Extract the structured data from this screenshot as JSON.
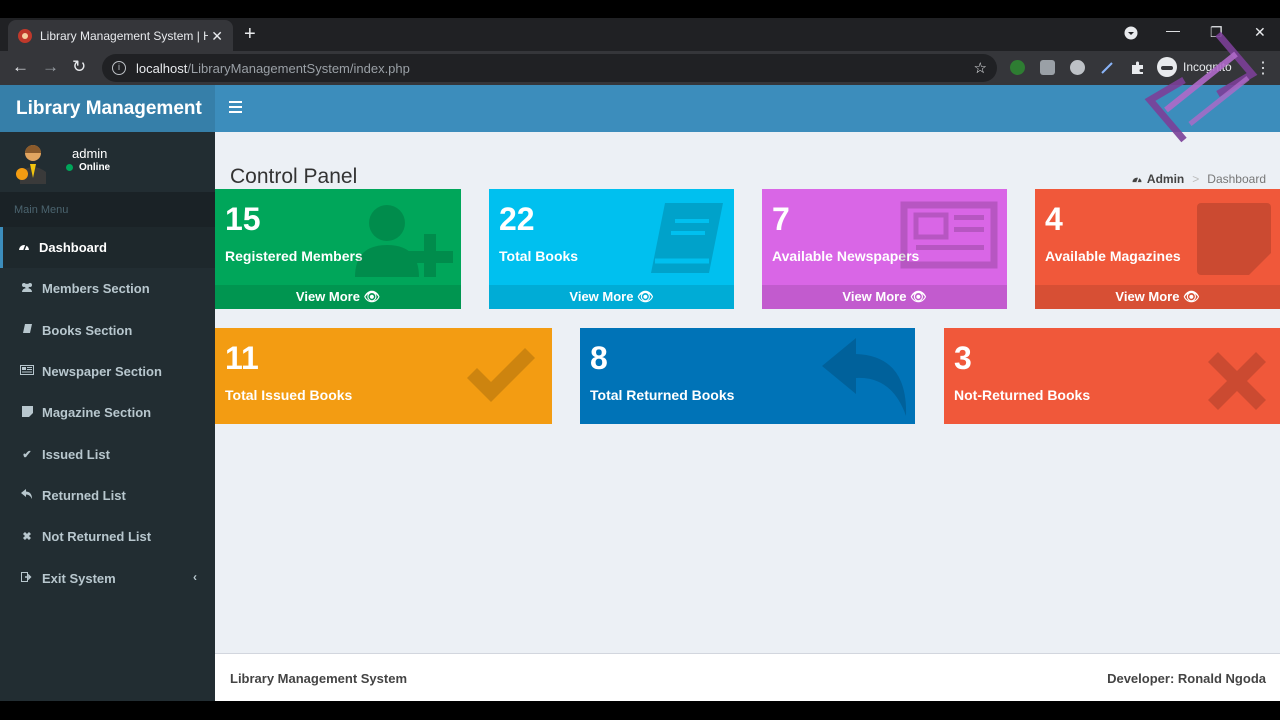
{
  "browser": {
    "tab_title": "Library Management System | Ho",
    "url_host": "localhost",
    "url_path": "/LibraryManagementSystem/index.php",
    "incognito_label": "Incognito"
  },
  "app": {
    "brand": "Library Management",
    "user": {
      "name": "admin",
      "status": "Online"
    },
    "menu_header": "Main Menu",
    "menu": [
      {
        "label": "Dashboard",
        "icon": "dashboard-icon",
        "active": true
      },
      {
        "label": "Members Section",
        "icon": "users-icon"
      },
      {
        "label": "Books Section",
        "icon": "book-icon"
      },
      {
        "label": "Newspaper Section",
        "icon": "newspaper-icon"
      },
      {
        "label": "Magazine Section",
        "icon": "sticky-note-icon"
      },
      {
        "label": "Issued List",
        "icon": "check-icon"
      },
      {
        "label": "Returned List",
        "icon": "reply-icon"
      },
      {
        "label": "Not Returned List",
        "icon": "times-icon"
      },
      {
        "label": "Exit System",
        "icon": "sign-out-icon"
      }
    ]
  },
  "page": {
    "title": "Control Panel",
    "breadcrumb": {
      "root": "Admin",
      "current": "Dashboard"
    }
  },
  "stats_row1": [
    {
      "number": "15",
      "label": "Registered Members",
      "footer": "View More",
      "color": "#00a65a",
      "icon": "user-plus-icon"
    },
    {
      "number": "22",
      "label": "Total Books",
      "footer": "View More",
      "color": "#00c0ef",
      "icon": "book-icon"
    },
    {
      "number": "7",
      "label": "Available Newspapers",
      "footer": "View More",
      "color": "#d966e6",
      "icon": "newspaper-icon"
    },
    {
      "number": "4",
      "label": "Available Magazines",
      "footer": "View More",
      "color": "#f0583a",
      "icon": "sticky-note-icon"
    }
  ],
  "stats_row2": [
    {
      "number": "11",
      "label": "Total Issued Books",
      "color": "#f39c12",
      "icon": "check-icon"
    },
    {
      "number": "8",
      "label": "Total Returned Books",
      "color": "#0073b7",
      "icon": "reply-icon"
    },
    {
      "number": "3",
      "label": "Not-Returned Books",
      "color": "#f0583a",
      "icon": "times-icon"
    }
  ],
  "footer": {
    "left": "Library Management System",
    "right": "Developer: Ronald Ngoda"
  }
}
